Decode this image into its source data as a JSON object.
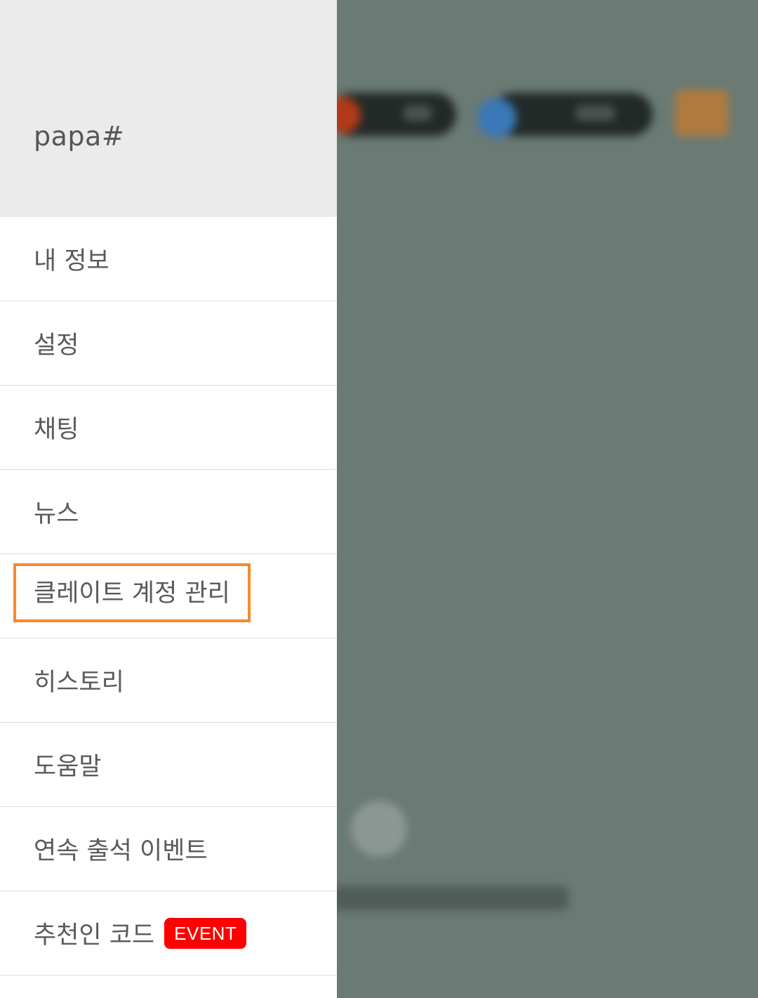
{
  "drawer": {
    "username": "papa#",
    "menu": [
      {
        "label": "내 정보"
      },
      {
        "label": "설정"
      },
      {
        "label": "채팅"
      },
      {
        "label": "뉴스"
      },
      {
        "label": "클레이트 계정 관리",
        "highlighted": true
      },
      {
        "label": "히스토리"
      },
      {
        "label": "도움말"
      },
      {
        "label": "연속 출석 이벤트"
      },
      {
        "label": "추천인 코드",
        "badge": "EVENT"
      }
    ]
  },
  "colors": {
    "header_bg": "#ebebeb",
    "overlay_bg": "#6a7a74",
    "highlight_border": "#f58a2c",
    "badge_bg": "#ff0000"
  }
}
